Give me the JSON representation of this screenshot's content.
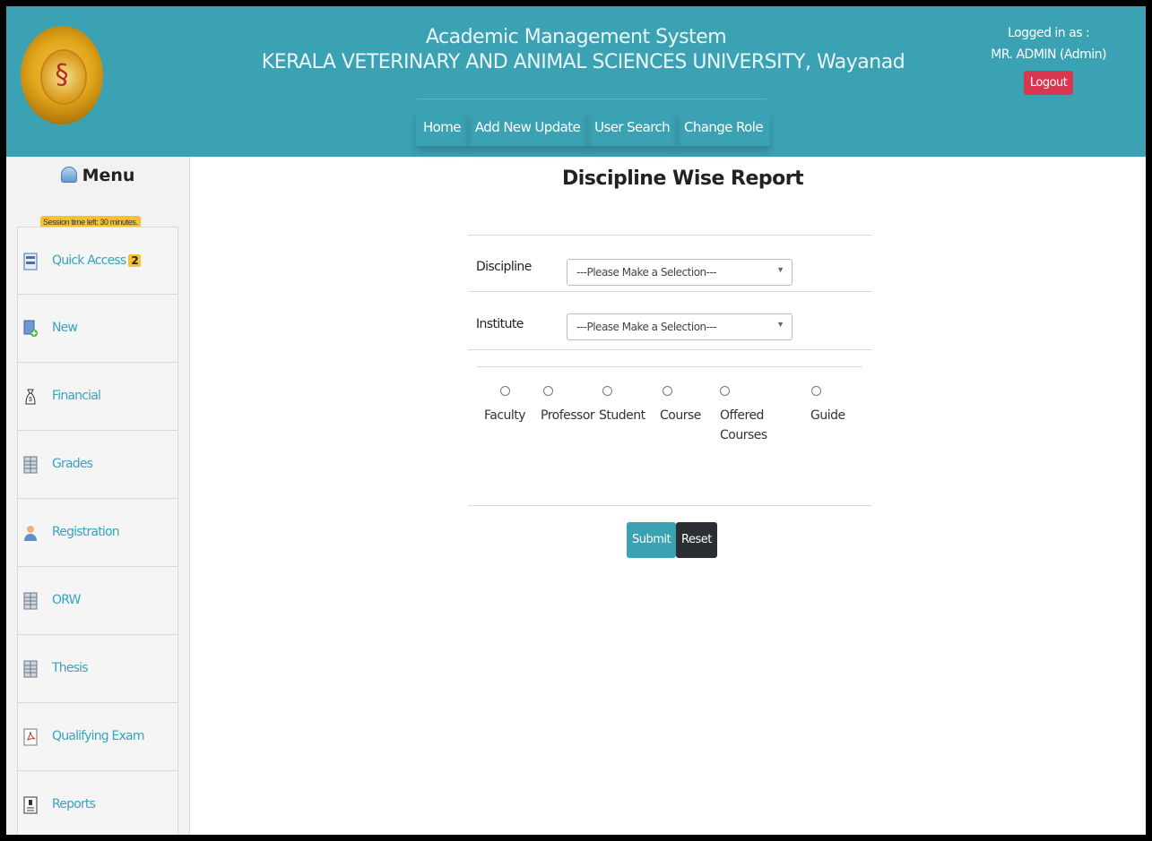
{
  "header": {
    "title_line1": "Academic Management System",
    "title_line2": "KERALA VETERINARY AND ANIMAL SCIENCES UNIVERSITY, Wayanad",
    "nav": [
      "Home",
      "Add New Update",
      "User Search",
      "Change Role"
    ],
    "logged_in_label": "Logged in as :",
    "user": "MR. ADMIN (Admin)",
    "logout_label": "Logout"
  },
  "sidebar": {
    "menu_label": "Menu",
    "session_text": "Session time left: 30 minutes.",
    "items": [
      {
        "label": "Quick Access",
        "badge": "2",
        "icon": "quick-access-icon"
      },
      {
        "label": "New",
        "icon": "new-document-icon"
      },
      {
        "label": "Financial",
        "icon": "money-bag-icon"
      },
      {
        "label": "Grades",
        "icon": "grid-icon"
      },
      {
        "label": "Registration",
        "icon": "user-icon"
      },
      {
        "label": "ORW",
        "icon": "grid-icon"
      },
      {
        "label": "Thesis",
        "icon": "grid-icon"
      },
      {
        "label": "Qualifying Exam",
        "icon": "pdf-icon"
      },
      {
        "label": "Reports",
        "icon": "report-icon"
      }
    ]
  },
  "main": {
    "title": "Discipline Wise Report",
    "discipline_label": "Discipline",
    "discipline_value": "---Please Make a Selection---",
    "institute_label": "Institute",
    "institute_value": "---Please Make a Selection---",
    "radios": [
      "Faculty",
      "Professor",
      "Student",
      "Course",
      "Offered Courses",
      "Guide"
    ],
    "submit_label": "Submit",
    "reset_label": "Reset"
  },
  "colors": {
    "header_bg": "#3ba2b4",
    "logout_bg": "#d9374f",
    "submit_bg": "#3ba2b4",
    "reset_bg": "#2b2f33",
    "badge_bg": "#f7c230",
    "link": "#37a3bf"
  }
}
